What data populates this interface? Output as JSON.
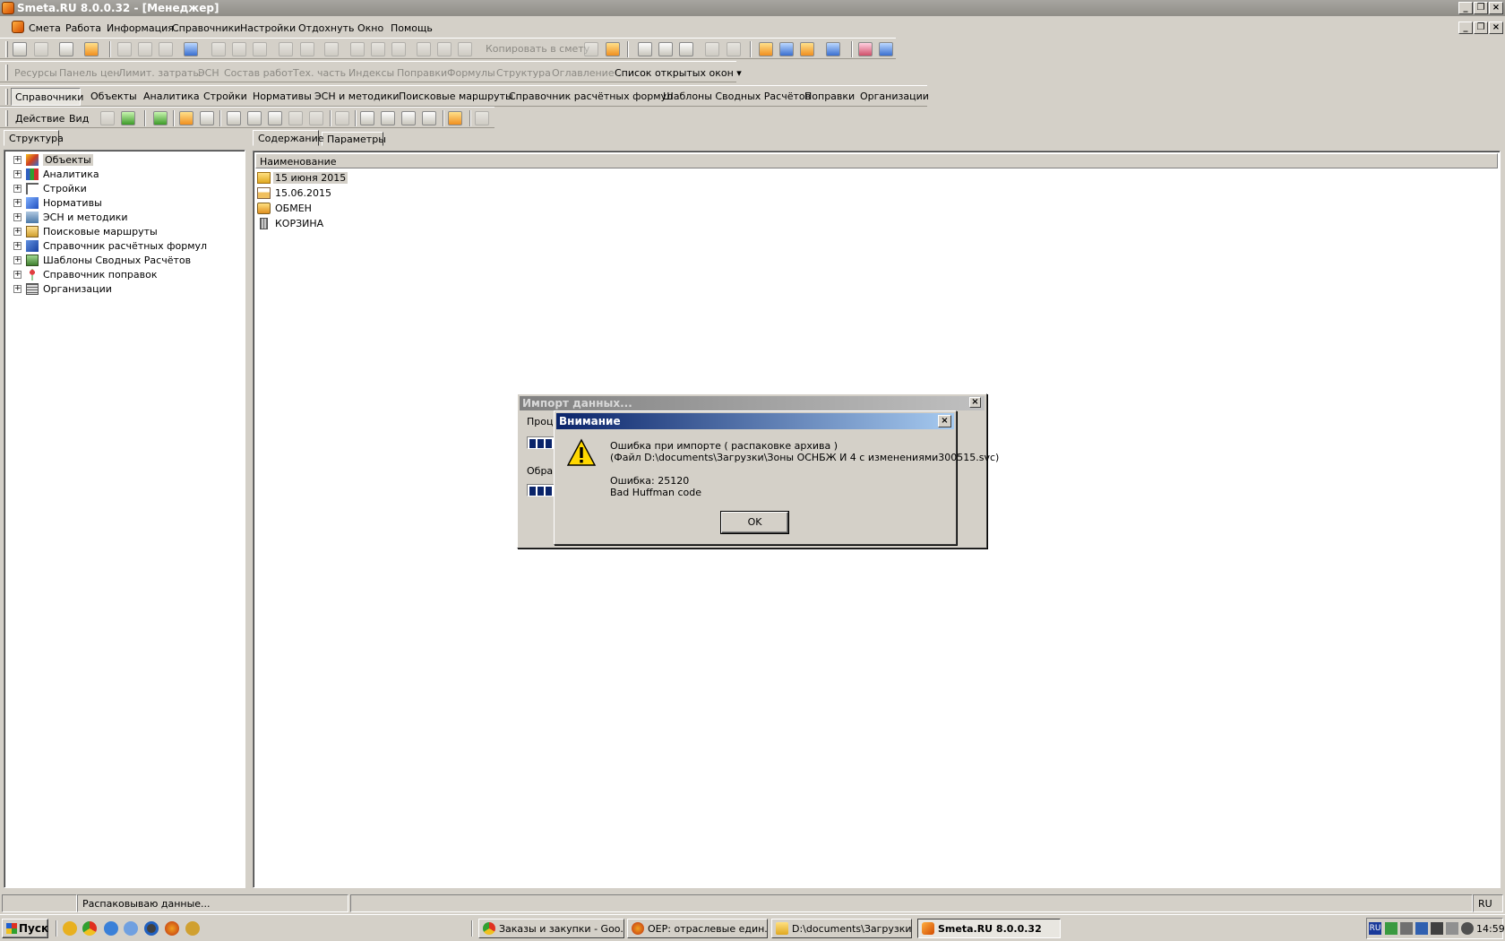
{
  "window": {
    "title": "Smeta.RU  8.0.0.32   - [Менеджер]"
  },
  "menu": [
    "Смета",
    "Работа",
    "Информация",
    "Справочники",
    "Настройки",
    "Отдохнуть",
    "Окно",
    "Помощь"
  ],
  "toolbar1": {
    "copy_to_estimate": "Копировать в смету"
  },
  "toolbar2": {
    "items": [
      "Ресурсы",
      "Панель цен",
      "Лимит. затраты",
      "ЭСН",
      "Состав работ",
      "Тех. часть",
      "Индексы",
      "Поправки",
      "Формулы",
      "Структура",
      "Оглавление"
    ],
    "open_windows": "Список открытых окон"
  },
  "navbar": {
    "items": [
      "Справочники",
      "Объекты",
      "Аналитика",
      "Стройки",
      "Нормативы",
      "ЭСН и методики",
      "Поисковые маршруты",
      "Справочник расчётных формул",
      "Шаблоны Сводных Расчётов",
      "Поправки",
      "Организации"
    ]
  },
  "toolbar3": {
    "action": "Действие",
    "view": "Вид"
  },
  "left_panel": {
    "tab": "Структура",
    "tree": [
      "Объекты",
      "Аналитика",
      "Стройки",
      "Нормативы",
      "ЭСН и методики",
      "Поисковые маршруты",
      "Справочник расчётных формул",
      "Шаблоны Сводных Расчётов",
      "Справочник поправок",
      "Организации"
    ]
  },
  "right_panel": {
    "tabs": [
      "Содержание",
      "Параметры"
    ],
    "column": "Наименование",
    "rows": [
      "15 июня 2015",
      "15.06.2015",
      "ОБМЕН",
      "КОРЗИНА"
    ]
  },
  "import_dialog": {
    "title": "Импорт данных...",
    "label1": "Проце",
    "label2": "Обра"
  },
  "alert_dialog": {
    "title": "Внимание",
    "line1": "Ошибка при импорте ( распаковке архива )",
    "line2": "(Файл D:\\documents\\Загрузки\\Зоны ОСНБЖ И 4 с изменениями300515.svc)",
    "line3": "Ошибка: 25120",
    "line4": "Bad Huffman code",
    "ok": "OK"
  },
  "statusbar": {
    "message": "Распаковываю данные...",
    "lang": "RU"
  },
  "taskbar": {
    "start": "Пуск",
    "tasks": [
      "Заказы и закупки - Goo...",
      "ОЕР: отраслевые един...",
      "D:\\documents\\Загрузки",
      "Smeta.RU  8.0.0.32"
    ],
    "lang": "RU",
    "clock": "14:59"
  },
  "colors": {
    "titlebar": "#9a9892",
    "dialog_title_from": "#0a246a",
    "dialog_title_to": "#a6caf0",
    "progress": "#0a246a"
  }
}
